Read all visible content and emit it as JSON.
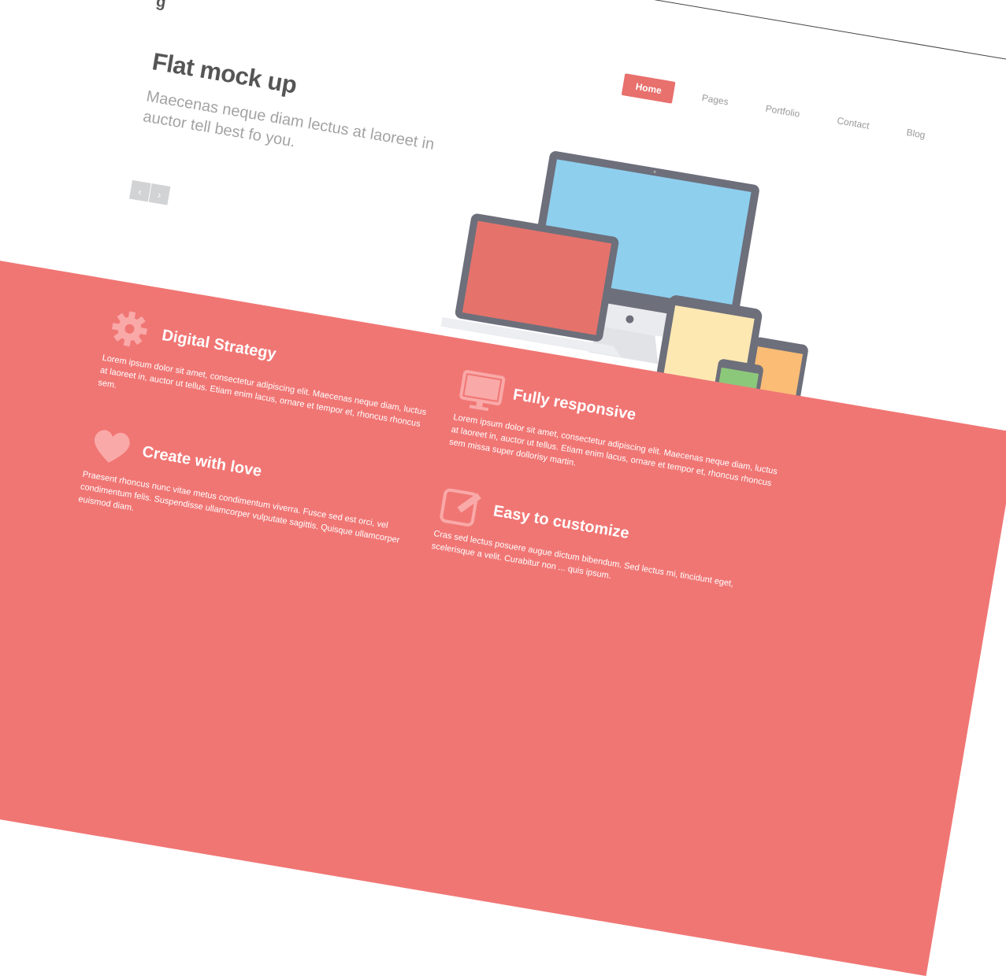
{
  "header": {
    "logo_fragment": "g"
  },
  "nav": {
    "items": [
      {
        "label": "Home",
        "active": true
      },
      {
        "label": "Pages",
        "active": false
      },
      {
        "label": "Portfolio",
        "active": false
      },
      {
        "label": "Contact",
        "active": false
      },
      {
        "label": "Blog",
        "active": false
      }
    ]
  },
  "hero": {
    "title": "Flat mock up",
    "subtitle": "Maecenas neque diam lectus at laoreet in auctor tell best fo you.",
    "prev_glyph": "‹",
    "next_glyph": "›"
  },
  "features": [
    {
      "icon": "gear-icon",
      "title": "Digital Strategy",
      "body": "Lorem ipsum dolor sit amet, consectetur adipiscing elit. Maecenas neque diam, luctus at laoreet in, auctor ut tellus. Etiam enim lacus, ornare et tempor et, rhoncus rhoncus sem."
    },
    {
      "icon": "heart-icon",
      "title": "Create with love",
      "body": "Praesent rhoncus nunc vitae metus condimentum viverra. Fusce sed est orci, vel condimentum felis. Suspendisse ullamcorper vulputate sagittis. Quisque ullamcorper euismod diam."
    },
    {
      "icon": "monitor-icon",
      "title": "Fully responsive",
      "body": "Lorem ipsum dolor sit amet, consectetur adipiscing elit. Maecenas neque diam, luctus at laoreet in, auctor ut tellus. Etiam enim lacus, ornare et tempor et, rhoncus rhoncus sem missa super dollorisy martin."
    },
    {
      "icon": "edit-icon",
      "title": "Easy to customize",
      "body": "Cras sed lectus posuere augue dictum bibendum. Sed lectus mi, tincidunt eget, scelerisque a velit. Curabitur non ... quis ipsum."
    }
  ],
  "colors": {
    "accent": "#f07674",
    "nav_active": "#e8706d",
    "heading": "#555555",
    "muted": "#a3a3a3",
    "monitor_screen": "#8ecfee",
    "laptop_screen": "#e5736b",
    "tablet_screen": "#fde8b2",
    "phone_green": "#8cc87a",
    "phone_orange": "#fbbc76"
  }
}
